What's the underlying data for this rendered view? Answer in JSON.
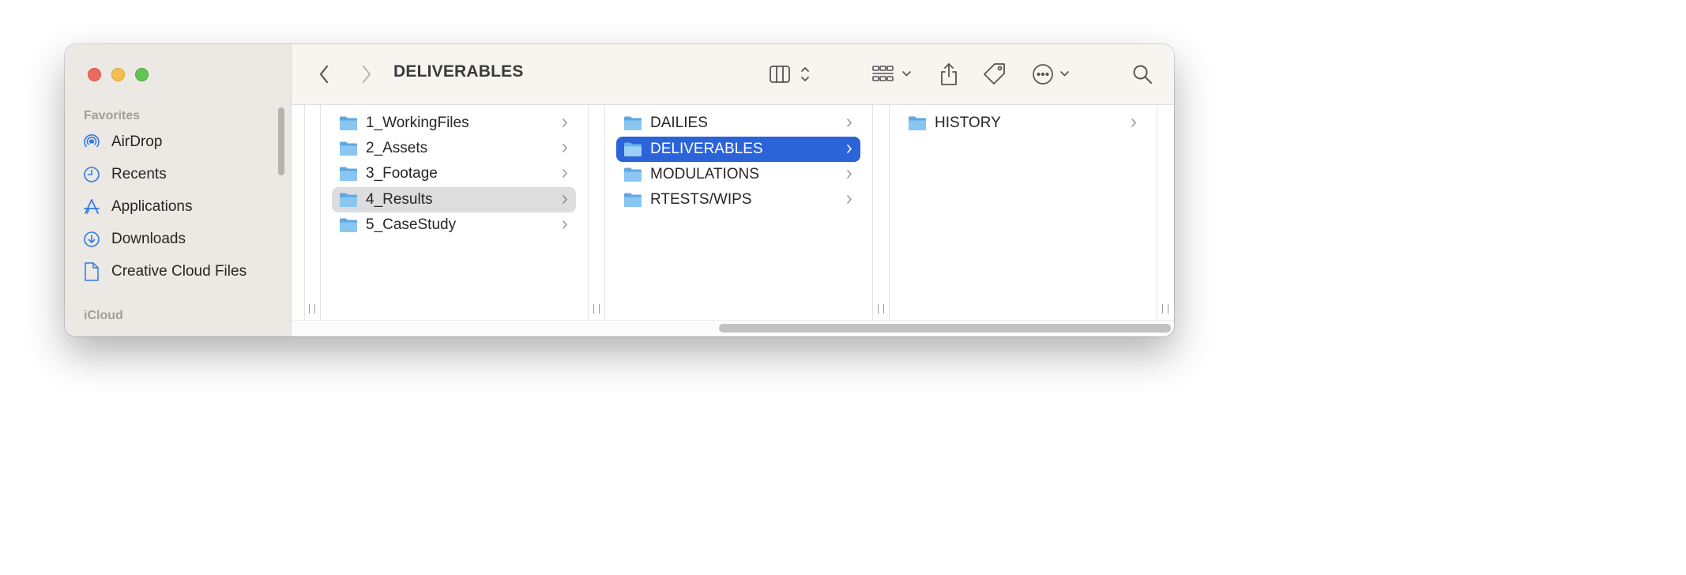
{
  "window": {
    "title": "DELIVERABLES"
  },
  "sidebar": {
    "sections": [
      {
        "heading": "Favorites",
        "items": [
          {
            "label": "AirDrop",
            "icon": "airdrop-icon"
          },
          {
            "label": "Recents",
            "icon": "clock-icon"
          },
          {
            "label": "Applications",
            "icon": "applications-icon"
          },
          {
            "label": "Downloads",
            "icon": "download-icon"
          },
          {
            "label": "Creative Cloud Files",
            "icon": "document-icon"
          }
        ]
      },
      {
        "heading": "iCloud",
        "items": []
      }
    ]
  },
  "toolbar": {
    "back_icon": "chevron-left-icon",
    "forward_icon": "chevron-right-icon",
    "view_icon": "column-view-icon",
    "group_icon": "grid-group-icon",
    "share_icon": "share-icon",
    "tag_icon": "tag-icon",
    "action_icon": "ellipsis-circle-icon",
    "search_icon": "search-icon"
  },
  "columns": [
    {
      "items": [
        {
          "name": "1_WorkingFiles",
          "selected": "none"
        },
        {
          "name": "2_Assets",
          "selected": "none"
        },
        {
          "name": "3_Footage",
          "selected": "none"
        },
        {
          "name": "4_Results",
          "selected": "inactive"
        },
        {
          "name": "5_CaseStudy",
          "selected": "none"
        }
      ]
    },
    {
      "items": [
        {
          "name": "DAILIES",
          "selected": "none"
        },
        {
          "name": "DELIVERABLES",
          "selected": "active"
        },
        {
          "name": "MODULATIONS",
          "selected": "none"
        },
        {
          "name": "RTESTS/WIPS",
          "selected": "none"
        }
      ]
    },
    {
      "items": [
        {
          "name": "HISTORY",
          "selected": "none"
        }
      ]
    }
  ],
  "colors": {
    "selection_active": "#2b63d9",
    "selection_inactive": "#dddddd",
    "folder_blue": "#6ab0e6",
    "sidebar_icon_blue": "#2f7ae5"
  }
}
